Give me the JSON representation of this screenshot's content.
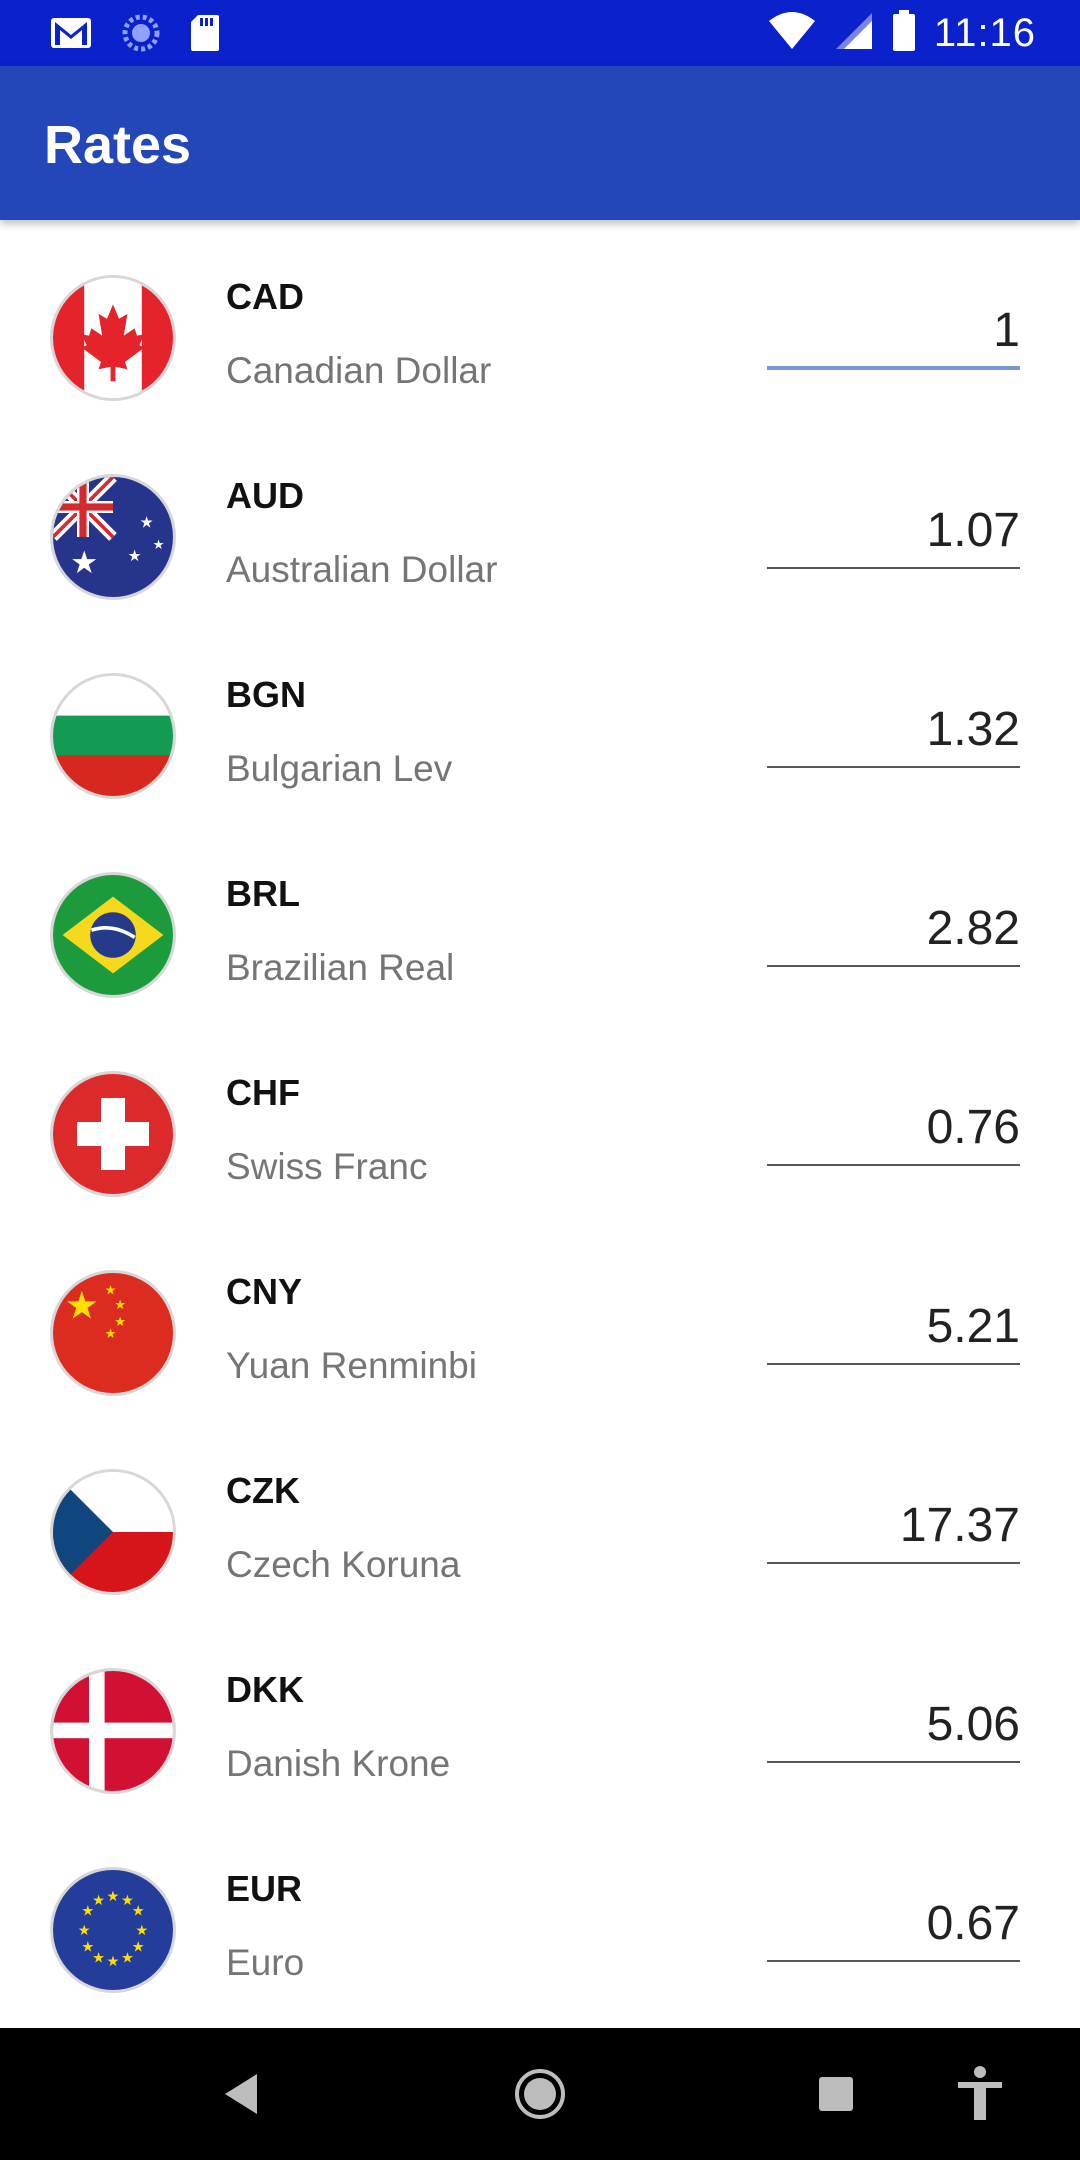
{
  "status_bar": {
    "time": "11:16",
    "left_icons": [
      "gmail-icon",
      "sync-icon",
      "sd-card-icon"
    ],
    "right_icons": [
      "wifi-icon",
      "cell-signal-icon",
      "battery-icon"
    ]
  },
  "app_bar": {
    "title": "Rates"
  },
  "rates": [
    {
      "code": "CAD",
      "name": "Canadian Dollar",
      "value": "1",
      "flag": "canada-flag-icon",
      "active": true
    },
    {
      "code": "AUD",
      "name": "Australian Dollar",
      "value": "1.07",
      "flag": "australia-flag-icon"
    },
    {
      "code": "BGN",
      "name": "Bulgarian Lev",
      "value": "1.32",
      "flag": "bulgaria-flag-icon"
    },
    {
      "code": "BRL",
      "name": "Brazilian Real",
      "value": "2.82",
      "flag": "brazil-flag-icon"
    },
    {
      "code": "CHF",
      "name": "Swiss Franc",
      "value": "0.76",
      "flag": "switzerland-flag-icon"
    },
    {
      "code": "CNY",
      "name": "Yuan Renminbi",
      "value": "5.21",
      "flag": "china-flag-icon"
    },
    {
      "code": "CZK",
      "name": "Czech Koruna",
      "value": "17.37",
      "flag": "czech-flag-icon"
    },
    {
      "code": "DKK",
      "name": "Danish Krone",
      "value": "5.06",
      "flag": "denmark-flag-icon"
    },
    {
      "code": "EUR",
      "name": "Euro",
      "value": "0.67",
      "flag": "eu-flag-icon"
    }
  ],
  "nav_bar": {
    "icons": [
      "back-icon",
      "home-icon",
      "recents-icon",
      "accessibility-icon"
    ]
  },
  "colors": {
    "status_bar": "#0a21cc",
    "app_bar": "#2347b8",
    "accent_underline": "#7c96de"
  }
}
